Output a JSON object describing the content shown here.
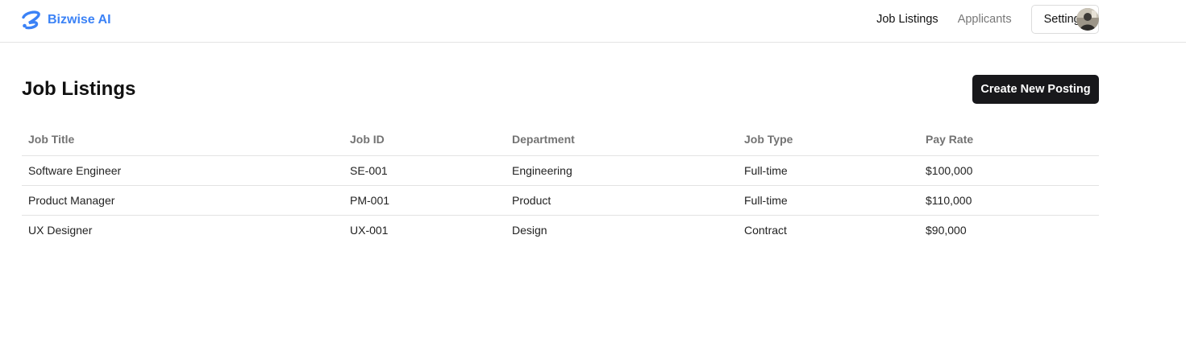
{
  "brand": {
    "name": "Bizwise AI",
    "logo_icon": "swirl-logo-icon",
    "color": "#3b82f6"
  },
  "nav": {
    "job_listings": "Job Listings",
    "applicants": "Applicants",
    "settings": "Settings",
    "avatar_icon": "user-avatar-icon"
  },
  "page": {
    "title": "Job Listings",
    "create_button": "Create New Posting"
  },
  "table": {
    "columns": [
      "Job Title",
      "Job ID",
      "Department",
      "Job Type",
      "Pay Rate"
    ],
    "rows": [
      [
        "Software Engineer",
        "SE-001",
        "Engineering",
        "Full-time",
        "$100,000"
      ],
      [
        "Product Manager",
        "PM-001",
        "Product",
        "Full-time",
        "$110,000"
      ],
      [
        "UX Designer",
        "UX-001",
        "Design",
        "Contract",
        "$90,000"
      ]
    ]
  },
  "colors": {
    "accent": "#3b82f6",
    "primary_button": "#18181b",
    "muted_text": "#737373",
    "border": "#e3e3e3"
  }
}
